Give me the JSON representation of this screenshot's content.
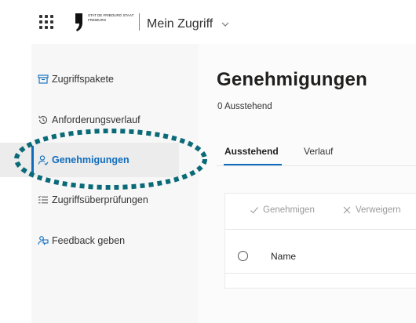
{
  "header": {
    "logo_text": "STAT DE FRIBOURG STAAT FREIBURG",
    "app_title": "Mein Zugriff"
  },
  "sidebar": {
    "items": [
      {
        "label": "Zugriffspakete",
        "icon": "package-icon"
      },
      {
        "label": "Anforderungsverlauf",
        "icon": "history-icon"
      },
      {
        "label": "Genehmigungen",
        "icon": "person-check-icon",
        "active": true
      },
      {
        "label": "Zugriffsüberprüfungen",
        "icon": "checklist-icon"
      },
      {
        "label": "Feedback geben",
        "icon": "feedback-icon"
      }
    ]
  },
  "main": {
    "title": "Genehmigungen",
    "pending_count": "0 Ausstehend",
    "tabs": [
      {
        "label": "Ausstehend",
        "active": true
      },
      {
        "label": "Verlauf"
      }
    ],
    "commands": [
      {
        "label": "Genehmigen",
        "icon": "checkmark-icon"
      },
      {
        "label": "Verweigern",
        "icon": "close-icon"
      }
    ],
    "table": {
      "columns": [
        "Name"
      ]
    }
  },
  "colors": {
    "accent": "#0f6cbd",
    "annotation_ring": "#0b6a78"
  }
}
